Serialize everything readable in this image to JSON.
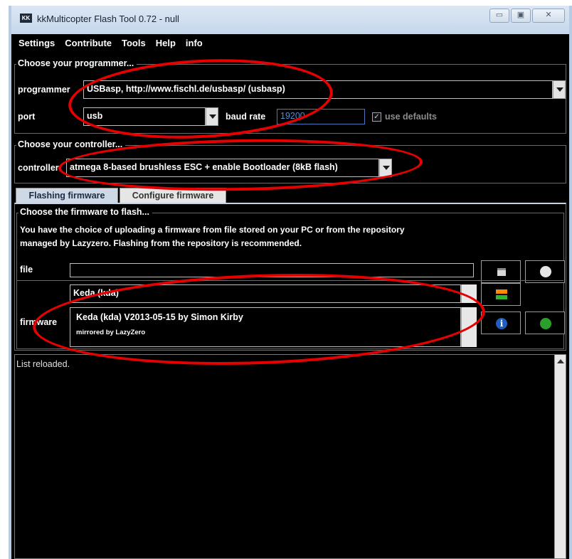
{
  "window": {
    "title": "kkMulticopter Flash Tool 0.72 - null",
    "icon_text": "KK",
    "controls": {
      "minimize": "▭",
      "maximize": "▣",
      "close": "✕"
    }
  },
  "menu": [
    "Settings",
    "Contribute",
    "Tools",
    "Help",
    "info"
  ],
  "programmer_group": {
    "title": "Choose your programmer...",
    "programmer_label": "programmer",
    "programmer_value": "USBasp, http://www.fischl.de/usbasp/ (usbasp)",
    "port_label": "port",
    "port_value": "usb",
    "baud_label": "baud rate",
    "baud_value": "19200",
    "use_defaults_label": "use defaults",
    "use_defaults_checked": true
  },
  "controller_group": {
    "title": "Choose your controller...",
    "controller_label": "controller",
    "controller_value": "atmega 8-based brushless ESC + enable Bootloader (8kB flash)"
  },
  "tabs": [
    {
      "label": "Flashing firmware",
      "active": true
    },
    {
      "label": "Configure firmware",
      "active": false
    }
  ],
  "firmware_group": {
    "title": "Choose the firmware to flash...",
    "description_line1": "You have the choice of uploading a firmware from file stored on your PC or from the repository",
    "description_line2": "managed by Lazyzero. Flashing from the repository is recommended.",
    "file_label": "file",
    "file_value": "",
    "firmware_label": "firmware",
    "firmware_family": "Keda (kda)",
    "firmware_version": "Keda (kda) V2013-05-15  by Simon Kirby",
    "firmware_mirror": "mirrored by LazyZero"
  },
  "log": {
    "text": "List reloaded."
  },
  "colors": {
    "annotation": "#e60000",
    "info_button": "#1f5fbf",
    "flash_button": "#2aa02a",
    "refresh_orange": "#ff8a00",
    "refresh_green": "#2fb52f"
  },
  "icons": {
    "save": "floppy-icon",
    "open": "circle-icon",
    "refresh": "refresh-arrows-icon",
    "info": "info-icon",
    "flash": "flash-go-icon"
  }
}
